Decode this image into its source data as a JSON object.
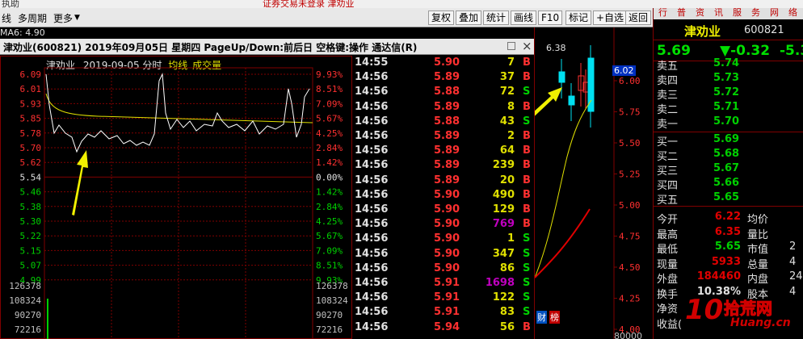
{
  "titlebar": {
    "left": "执助",
    "center": "证券交易未登录  津劝业"
  },
  "toolbar": {
    "left_items": [
      "线",
      "多周期",
      "更多"
    ],
    "buttons": [
      "复权",
      "叠加",
      "统计",
      "画线",
      "F10",
      "标记",
      "+自选",
      "返回"
    ]
  },
  "ma_label": "MA6: 4.90",
  "chart_header": "津劝业(600821) 2019年09月05日 星期四 PageUp/Down:前后日 空格键:操作 通达信(R)",
  "intraday": {
    "stock_name": "津劝业",
    "date_label": "2019-09-05 分时",
    "avg_line_label": "均线",
    "volume_label": "成交量"
  },
  "colors": {
    "price_line": "#ffffff",
    "avg_line": "#e0e000",
    "up": "#ff3030",
    "down": "#00d000",
    "grid": "#800000",
    "arrow": "#f0f000"
  },
  "price_axis_left": [
    "6.09",
    "6.01",
    "5.93",
    "5.85",
    "5.78",
    "5.70",
    "5.62",
    "5.54",
    "5.46",
    "5.38",
    "5.30",
    "5.22",
    "5.15",
    "5.07",
    "4.99"
  ],
  "price_axis_right": [
    "9.93%",
    "8.51%",
    "7.09%",
    "5.67%",
    "4.25%",
    "2.84%",
    "1.42%",
    "0.00%",
    "1.42%",
    "2.84%",
    "4.25%",
    "5.67%",
    "7.09%",
    "8.51%",
    "9.93%"
  ],
  "volume_axis": [
    "126378",
    "108324",
    "90270",
    "72216"
  ],
  "ticks": [
    {
      "time": "14:55",
      "price": "5.90",
      "vol": "7",
      "side": "B"
    },
    {
      "time": "14:56",
      "price": "5.89",
      "vol": "37",
      "side": "B"
    },
    {
      "time": "14:56",
      "price": "5.88",
      "vol": "72",
      "side": "S"
    },
    {
      "time": "14:56",
      "price": "5.89",
      "vol": "8",
      "side": "B"
    },
    {
      "time": "14:56",
      "price": "5.88",
      "vol": "43",
      "side": "S"
    },
    {
      "time": "14:56",
      "price": "5.89",
      "vol": "2",
      "side": "B"
    },
    {
      "time": "14:56",
      "price": "5.89",
      "vol": "64",
      "side": "B"
    },
    {
      "time": "14:56",
      "price": "5.89",
      "vol": "239",
      "side": "B"
    },
    {
      "time": "14:56",
      "price": "5.89",
      "vol": "20",
      "side": "B"
    },
    {
      "time": "14:56",
      "price": "5.90",
      "vol": "490",
      "side": "B"
    },
    {
      "time": "14:56",
      "price": "5.90",
      "vol": "129",
      "side": "B"
    },
    {
      "time": "14:56",
      "price": "5.90",
      "vol": "769",
      "side": "B"
    },
    {
      "time": "14:56",
      "price": "5.90",
      "vol": "1",
      "side": "S"
    },
    {
      "time": "14:56",
      "price": "5.90",
      "vol": "347",
      "side": "S"
    },
    {
      "time": "14:56",
      "price": "5.90",
      "vol": "86",
      "side": "S"
    },
    {
      "time": "14:56",
      "price": "5.91",
      "vol": "1698",
      "side": "S"
    },
    {
      "time": "14:56",
      "price": "5.91",
      "vol": "122",
      "side": "S"
    },
    {
      "time": "14:56",
      "price": "5.91",
      "vol": "83",
      "side": "S"
    },
    {
      "time": "14:56",
      "price": "5.94",
      "vol": "56",
      "side": "B"
    }
  ],
  "kline": {
    "high_label": "6.38",
    "price_ticks": [
      "6.00",
      "5.75",
      "5.50",
      "5.25",
      "5.00",
      "4.75",
      "4.50",
      "4.25",
      "4.00"
    ],
    "current_price_tag": "6.02",
    "bottom_labels": [
      "财",
      "榜"
    ],
    "volume_tick": "80000"
  },
  "quote": {
    "name": "津劝业",
    "code": "600821",
    "price": "5.69",
    "change": "▼-0.32",
    "change_pct": "-5.3",
    "asks": [
      {
        "label": "卖五",
        "price": "5.74"
      },
      {
        "label": "卖四",
        "price": "5.73"
      },
      {
        "label": "卖三",
        "price": "5.72"
      },
      {
        "label": "卖二",
        "price": "5.71"
      },
      {
        "label": "卖一",
        "price": "5.70"
      }
    ],
    "bids": [
      {
        "label": "买一",
        "price": "5.69"
      },
      {
        "label": "买二",
        "price": "5.68"
      },
      {
        "label": "买三",
        "price": "5.67"
      },
      {
        "label": "买四",
        "price": "5.66"
      },
      {
        "label": "买五",
        "price": "5.65"
      }
    ],
    "stats": [
      {
        "label": "今开",
        "value": "6.22",
        "label2": "均价",
        "value2": ""
      },
      {
        "label": "最高",
        "value": "6.35",
        "label2": "量比",
        "value2": ""
      },
      {
        "label": "最低",
        "value": "5.65",
        "label2": "市值",
        "value2": "2"
      },
      {
        "label": "现量",
        "value": "5933",
        "label2": "总量",
        "value2": "4"
      },
      {
        "label": "外盘",
        "value": "184460",
        "label2": "内盘",
        "value2": "24"
      },
      {
        "label": "换手",
        "value": "10.38%",
        "label2": "股本",
        "value2": "4"
      },
      {
        "label": "净资",
        "value": "",
        "label2": "",
        "value2": ""
      },
      {
        "label": "收益(",
        "value": "",
        "label2": "",
        "value2": ""
      }
    ],
    "top_tabs": [
      "行",
      "普",
      "资",
      "讯",
      "服",
      "务",
      "网",
      "络"
    ]
  },
  "watermark": {
    "num": "10",
    "name": "拾荒网",
    "url": "Huang.cn"
  }
}
